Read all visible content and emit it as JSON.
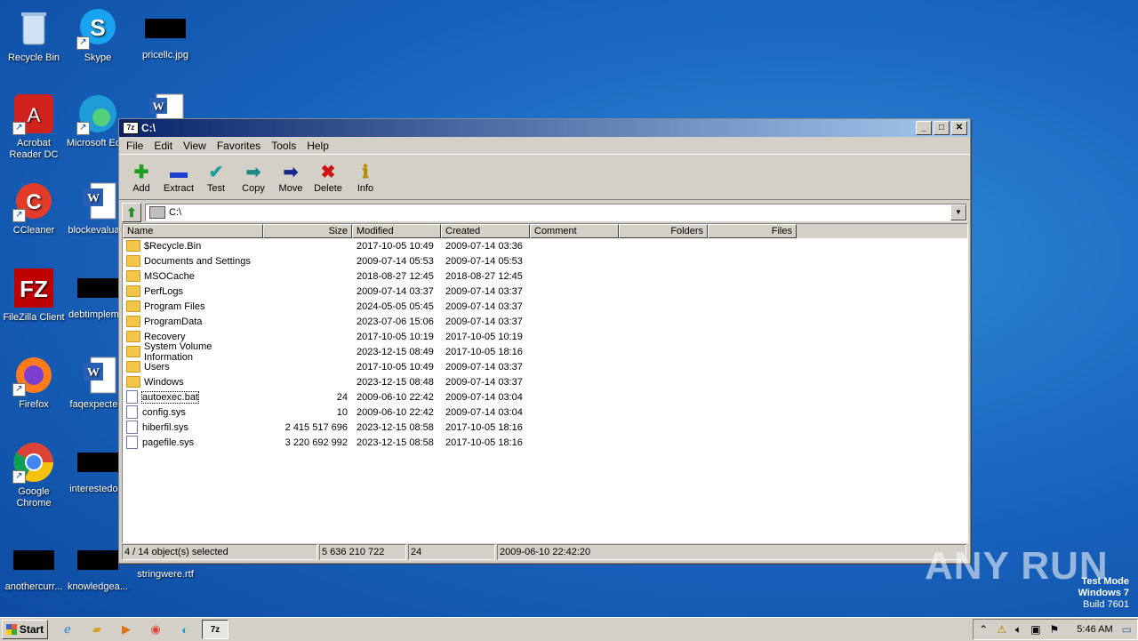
{
  "desktop": {
    "icons": [
      {
        "label": "Recycle Bin"
      },
      {
        "label": "Skype"
      },
      {
        "label": "pricellc.jpg"
      },
      {
        "label": "Acrobat Reader DC"
      },
      {
        "label": "Microsoft Ed..."
      },
      {
        "label": "CCleaner"
      },
      {
        "label": "blockevalua..."
      },
      {
        "label": "FileZilla Client"
      },
      {
        "label": "debtimplem..."
      },
      {
        "label": "Firefox"
      },
      {
        "label": "faqexpecte..."
      },
      {
        "label": "Google Chrome"
      },
      {
        "label": "interestedo..."
      },
      {
        "label": "anothercurr..."
      },
      {
        "label": "knowledgea..."
      },
      {
        "label": "stringwere.rtf"
      }
    ]
  },
  "window": {
    "title": "C:\\",
    "app_icon": "7z",
    "menu": [
      "File",
      "Edit",
      "View",
      "Favorites",
      "Tools",
      "Help"
    ],
    "toolbar": [
      {
        "label": "Add",
        "icon": "plus-icon"
      },
      {
        "label": "Extract",
        "icon": "minus-icon"
      },
      {
        "label": "Test",
        "icon": "check-icon"
      },
      {
        "label": "Copy",
        "icon": "copy-arrow-icon"
      },
      {
        "label": "Move",
        "icon": "move-arrow-icon"
      },
      {
        "label": "Delete",
        "icon": "delete-x-icon"
      },
      {
        "label": "Info",
        "icon": "info-icon"
      }
    ],
    "address": "C:\\",
    "columns": [
      "Name",
      "Size",
      "Modified",
      "Created",
      "Comment",
      "Folders",
      "Files"
    ],
    "rows": [
      {
        "name": "$Recycle.Bin",
        "size": "",
        "modified": "2017-10-05 10:49",
        "created": "2009-07-14 03:36",
        "type": "folder"
      },
      {
        "name": "Documents and Settings",
        "size": "",
        "modified": "2009-07-14 05:53",
        "created": "2009-07-14 05:53",
        "type": "folder"
      },
      {
        "name": "MSOCache",
        "size": "",
        "modified": "2018-08-27 12:45",
        "created": "2018-08-27 12:45",
        "type": "folder"
      },
      {
        "name": "PerfLogs",
        "size": "",
        "modified": "2009-07-14 03:37",
        "created": "2009-07-14 03:37",
        "type": "folder"
      },
      {
        "name": "Program Files",
        "size": "",
        "modified": "2024-05-05 05:45",
        "created": "2009-07-14 03:37",
        "type": "folder"
      },
      {
        "name": "ProgramData",
        "size": "",
        "modified": "2023-07-06 15:06",
        "created": "2009-07-14 03:37",
        "type": "folder"
      },
      {
        "name": "Recovery",
        "size": "",
        "modified": "2017-10-05 10:19",
        "created": "2017-10-05 10:19",
        "type": "folder"
      },
      {
        "name": "System Volume Information",
        "size": "",
        "modified": "2023-12-15 08:49",
        "created": "2017-10-05 18:16",
        "type": "folder"
      },
      {
        "name": "Users",
        "size": "",
        "modified": "2017-10-05 10:49",
        "created": "2009-07-14 03:37",
        "type": "folder"
      },
      {
        "name": "Windows",
        "size": "",
        "modified": "2023-12-15 08:48",
        "created": "2009-07-14 03:37",
        "type": "folder"
      },
      {
        "name": "autoexec.bat",
        "size": "24",
        "modified": "2009-06-10 22:42",
        "created": "2009-07-14 03:04",
        "type": "file"
      },
      {
        "name": "config.sys",
        "size": "10",
        "modified": "2009-06-10 22:42",
        "created": "2009-07-14 03:04",
        "type": "file"
      },
      {
        "name": "hiberfil.sys",
        "size": "2 415 517 696",
        "modified": "2023-12-15 08:58",
        "created": "2017-10-05 18:16",
        "type": "file"
      },
      {
        "name": "pagefile.sys",
        "size": "3 220 692 992",
        "modified": "2023-12-15 08:58",
        "created": "2017-10-05 18:16",
        "type": "file"
      }
    ],
    "status": {
      "selection": "4 / 14 object(s) selected",
      "total_size": "5 636 210 722",
      "selected_size": "24",
      "date": "2009-06-10 22:42:20"
    }
  },
  "taskbar": {
    "start_label": "Start",
    "time": "5:46 AM"
  },
  "watermark": {
    "line1": "Test Mode",
    "line2": "Windows 7",
    "line3": "Build 7601",
    "brand": "ANY RUN"
  }
}
